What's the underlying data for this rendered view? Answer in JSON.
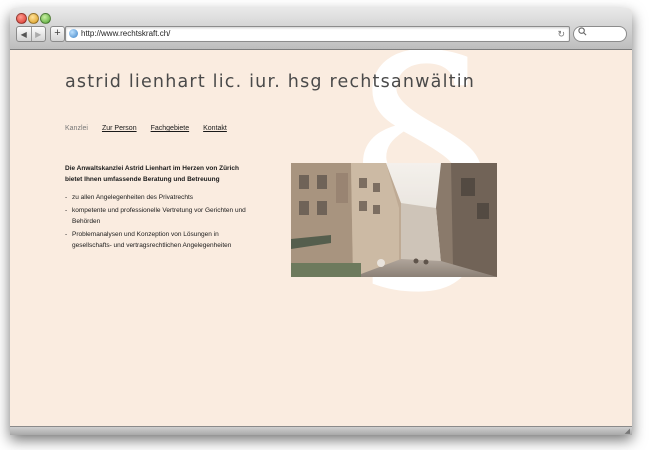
{
  "browser": {
    "url": "http://www.rechtskraft.ch/",
    "back_label": "◀",
    "forward_label": "▶",
    "add_label": "+",
    "reload_label": "↻",
    "search_icon": "search-icon"
  },
  "site": {
    "title": "astrid lienhart lic. iur. hsg rechtsanwältin",
    "nav": [
      "Kanzlei",
      "Zur Person",
      "Fachgebiete",
      "Kontakt"
    ],
    "nav_current": "Kanzlei",
    "lead_line1": "Die Anwaltskanzlei Astrid Lienhart im Herzen von Zürich",
    "lead_line2": "bietet Ihnen umfassende Beratung und Betreuung",
    "bullets": [
      "zu allen Angelegenheiten des Privatrechts",
      "kompetente und professionelle Vertretung vor Gerichten und Behörden",
      "Problemanalysen und Konzeption von Lösungen in gesellschafts- und vertragsrechtlichen Angelegenheiten"
    ],
    "decor_symbol": "§"
  },
  "colors": {
    "page_background": "#faece0",
    "text": "#1a1a1a",
    "title": "#4a4a4a"
  }
}
